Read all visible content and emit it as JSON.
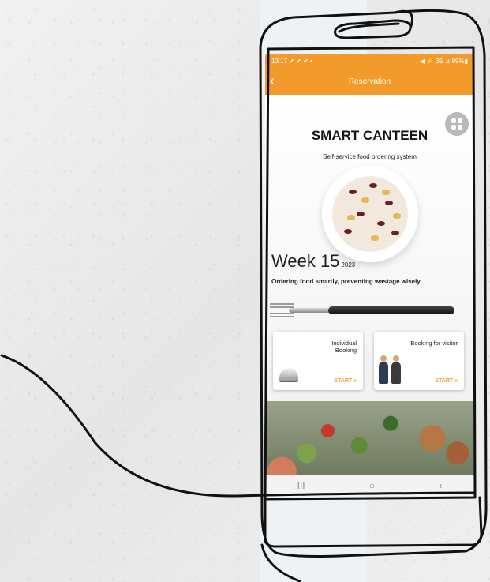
{
  "status_bar": {
    "time": "13:17 ✔ ✔ ✔ •",
    "indicators": "◀ ⚡ 35 ⊿ 99%▮"
  },
  "app_bar": {
    "back_icon": "‹",
    "title": "Reservation"
  },
  "main": {
    "heading": "SMART CANTEEN",
    "subheading": "Self-service food ordering system",
    "week_label": "Week 15",
    "year": "2023",
    "slogan": "Ordering food smartly, preventing wastage wisely"
  },
  "cards": [
    {
      "label": "Individual Booking",
      "action": "START »"
    },
    {
      "label": "Booking for visitor",
      "action": "START »"
    }
  ],
  "nav_bar": {
    "recents": "III",
    "home": "○",
    "back": "‹"
  },
  "colors": {
    "accent": "#f39a2c"
  }
}
